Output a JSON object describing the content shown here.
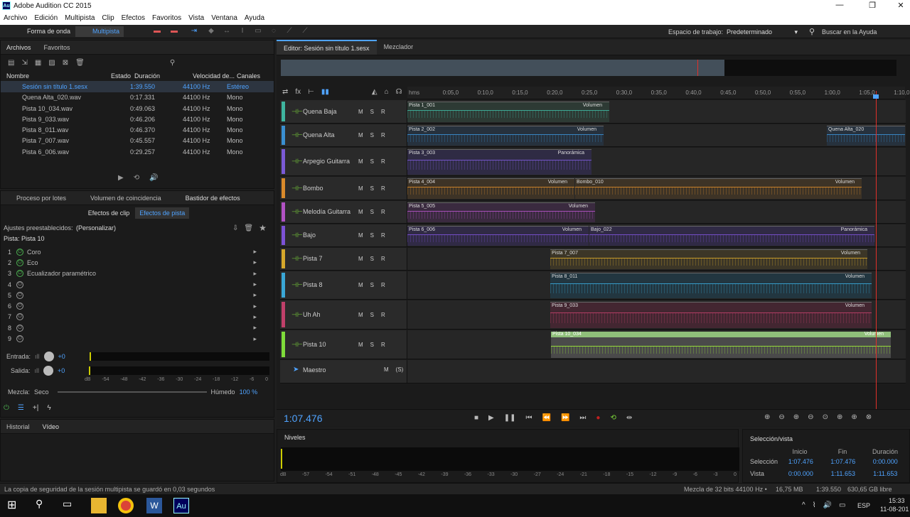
{
  "titlebar": {
    "title": "Adobe Audition CC 2015",
    "logo": "Au",
    "minimize": "—",
    "maximize": "❐",
    "close": "✕"
  },
  "menu": [
    "Archivo",
    "Edición",
    "Multipista",
    "Clip",
    "Efectos",
    "Favoritos",
    "Vista",
    "Ventana",
    "Ayuda"
  ],
  "toolbar": {
    "waveform": "Forma de onda",
    "multitrack": "Multipista",
    "workspace_label": "Espacio de trabajo:",
    "workspace_value": "Predeterminado",
    "help_search": "Buscar en la Ayuda"
  },
  "files": {
    "tabs": [
      "Archivos",
      "Favoritos"
    ],
    "columns": [
      "Nombre",
      "Estado",
      "Duración",
      "Velocidad de...",
      "Canales"
    ],
    "rows": [
      {
        "name": "Sesión sin título 1.sesx",
        "duration": "1:39.550",
        "rate": "44100 Hz",
        "channels": "Estéreo"
      },
      {
        "name": "Quena Alta_020.wav",
        "duration": "0:17.331",
        "rate": "44100 Hz",
        "channels": "Mono"
      },
      {
        "name": "Pista 10_034.wav",
        "duration": "0:49.063",
        "rate": "44100 Hz",
        "channels": "Mono"
      },
      {
        "name": "Pista 9_033.wav",
        "duration": "0:46.206",
        "rate": "44100 Hz",
        "channels": "Mono"
      },
      {
        "name": "Pista 8_011.wav",
        "duration": "0:46.370",
        "rate": "44100 Hz",
        "channels": "Mono"
      },
      {
        "name": "Pista 7_007.wav",
        "duration": "0:45.557",
        "rate": "44100 Hz",
        "channels": "Mono"
      },
      {
        "name": "Pista 6_006.wav",
        "duration": "0:29.257",
        "rate": "44100 Hz",
        "channels": "Mono"
      }
    ]
  },
  "effects": {
    "tabs": [
      "Proceso por lotes",
      "Volumen de coincidencia",
      "Bastidor de efectos"
    ],
    "subtabs": [
      "Efectos de clip",
      "Efectos de pista"
    ],
    "preset_label": "Ajustes preestablecidos:",
    "preset_value": "(Personalizar)",
    "track_label": "Pista: Pista 10",
    "slots": [
      {
        "n": "1",
        "name": "Coro",
        "on": true
      },
      {
        "n": "2",
        "name": "Eco",
        "on": true
      },
      {
        "n": "3",
        "name": "Ecualizador paramétrico",
        "on": true
      },
      {
        "n": "4",
        "name": "",
        "on": false
      },
      {
        "n": "5",
        "name": "",
        "on": false
      },
      {
        "n": "6",
        "name": "",
        "on": false
      },
      {
        "n": "7",
        "name": "",
        "on": false
      },
      {
        "n": "8",
        "name": "",
        "on": false
      },
      {
        "n": "9",
        "name": "",
        "on": false
      }
    ],
    "input_label": "Entrada:",
    "input_value": "+0",
    "output_label": "Salida:",
    "output_value": "+0",
    "meter_scale": [
      "dB",
      "-54",
      "-48",
      "-42",
      "-36",
      "-30",
      "-24",
      "-18",
      "-12",
      "-6",
      "0"
    ],
    "mix_label": "Mezcla:",
    "mix_dry": "Seco",
    "mix_wet": "Húmedo",
    "mix_value": "100 %"
  },
  "bottom_left_tabs": [
    "Historial",
    "Vídeo"
  ],
  "editor": {
    "tab": "Editor: Sesión sin título 1.sesx",
    "mixer_tab": "Mezclador",
    "time": "1:07.476"
  },
  "ruler": [
    "hms",
    "0:05,0",
    "0:10,0",
    "0:15,0",
    "0:20,0",
    "0:25,0",
    "0:30,0",
    "0:35,0",
    "0:40,0",
    "0:45,0",
    "0:50,0",
    "0:55,0",
    "1:00,0",
    "1:05,0",
    "1:10,0"
  ],
  "tracks": [
    {
      "name": "Quena Baja",
      "color": "#3fb59f",
      "clips": [
        {
          "label": "Pista 1_001",
          "param": "Volumen",
          "bg": "#2d3a34"
        }
      ]
    },
    {
      "name": "Quena Alta",
      "color": "#3a8fd1",
      "clips": [
        {
          "label": "Pista 2_002",
          "param": "Volumen",
          "bg": "#26313d"
        },
        {
          "label": "Quena Alta_020",
          "param": "",
          "bg": "#26313d"
        }
      ]
    },
    {
      "name": "Arpegio Guitarra",
      "color": "#7b5ad6",
      "clips": [
        {
          "label": "Pista 3_003",
          "param": "Panorámica",
          "bg": "#2f2b44"
        }
      ]
    },
    {
      "name": "Bombo",
      "color": "#d98a2b",
      "clips": [
        {
          "label": "Pista 4_004",
          "param": "Volumen",
          "bg": "#3d3326"
        },
        {
          "label": "Bombo_010",
          "param": "Volumen",
          "bg": "#3d3326"
        }
      ]
    },
    {
      "name": "Melodía Guitarra",
      "color": "#b252c4",
      "clips": [
        {
          "label": "Pista 5_005",
          "param": "Volumen",
          "bg": "#3a2a3f"
        }
      ]
    },
    {
      "name": "Bajo",
      "color": "#7d52d6",
      "clips": [
        {
          "label": "Pista 6_006",
          "param": "Volumen",
          "bg": "#302a45"
        },
        {
          "label": "Bajo_022",
          "param": "Panorámica",
          "bg": "#302a45"
        }
      ]
    },
    {
      "name": "Pista 7",
      "color": "#d6a82b",
      "clips": [
        {
          "label": "Pista 7_007",
          "param": "Volumen",
          "bg": "#3c3627"
        }
      ]
    },
    {
      "name": "Pista 8",
      "color": "#3aa7d6",
      "clips": [
        {
          "label": "Pista 8_011",
          "param": "Volumen",
          "bg": "#223640"
        }
      ]
    },
    {
      "name": "Uh Ah",
      "color": "#c0406a",
      "clips": [
        {
          "label": "Pista 9_033",
          "param": "Volumen",
          "bg": "#432631"
        }
      ]
    },
    {
      "name": "Pista 10",
      "color": "#7fdc3a",
      "clips": [
        {
          "label": "Pista 10_034",
          "param": "Volumen",
          "bg": "#4a4a4a"
        }
      ]
    }
  ],
  "master": {
    "name": "Maestro",
    "m": "M",
    "s": "(S)"
  },
  "track_buttons": {
    "m": "M",
    "s": "S",
    "r": "R"
  },
  "levels": {
    "title": "Niveles",
    "scale": [
      "dB",
      "-57",
      "-54",
      "-51",
      "-48",
      "-45",
      "-42",
      "-39",
      "-36",
      "-33",
      "-30",
      "-27",
      "-24",
      "-21",
      "-18",
      "-15",
      "-12",
      "-9",
      "-6",
      "-3",
      "0"
    ]
  },
  "selection": {
    "title": "Selección/vista",
    "cols": [
      "Inicio",
      "Fin",
      "Duración"
    ],
    "sel_label": "Selección",
    "sel": [
      "1:07.476",
      "1:07.476",
      "0:00.000"
    ],
    "view_label": "Vista",
    "view": [
      "0:00.000",
      "1:11.653",
      "1:11.653"
    ]
  },
  "status": {
    "message": "La copia de seguridad de la sesión multipista se guardó en 0,03 segundos",
    "mix": "Mezcla de 32 bits 44100 Hz •",
    "mem": "16,75 MB",
    "dur": "1:39.550",
    "free": "630,65 GB libre"
  },
  "taskbar": {
    "lang": "ESP",
    "time": "15:33",
    "date": "11-08-201"
  },
  "colors": {
    "accent": "#4fa3ff",
    "playhead": "#e0302a",
    "bg": "#1e1e1e"
  }
}
